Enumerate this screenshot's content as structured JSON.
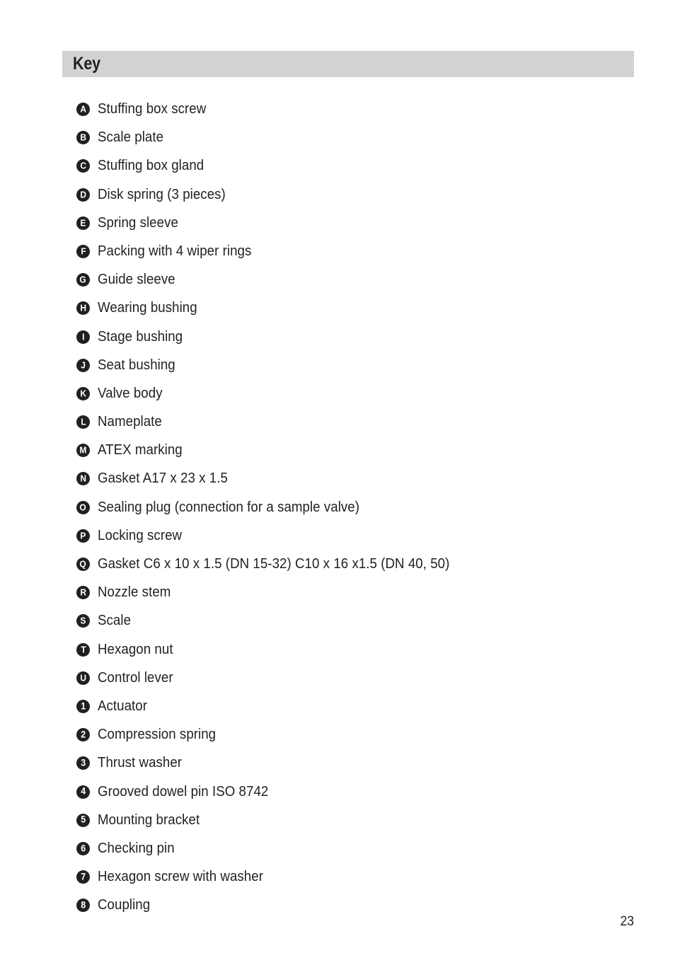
{
  "section": {
    "title": "Key",
    "header_bg": "#d2d2d2",
    "text_color": "#231f20"
  },
  "key_items": [
    {
      "marker": "A",
      "marker_type": "letter",
      "label": "Stuffing box screw"
    },
    {
      "marker": "B",
      "marker_type": "letter",
      "label": "Scale plate"
    },
    {
      "marker": "C",
      "marker_type": "letter",
      "label": "Stuffing box gland"
    },
    {
      "marker": "D",
      "marker_type": "letter",
      "label": "Disk spring (3 pieces)"
    },
    {
      "marker": "E",
      "marker_type": "letter",
      "label": "Spring sleeve"
    },
    {
      "marker": "F",
      "marker_type": "letter",
      "label": "Packing with 4 wiper rings"
    },
    {
      "marker": "G",
      "marker_type": "letter",
      "label": "Guide sleeve"
    },
    {
      "marker": "H",
      "marker_type": "letter",
      "label": "Wearing bushing"
    },
    {
      "marker": "I",
      "marker_type": "letter",
      "label": "Stage bushing"
    },
    {
      "marker": "J",
      "marker_type": "letter",
      "label": "Seat bushing"
    },
    {
      "marker": "K",
      "marker_type": "letter",
      "label": "Valve body"
    },
    {
      "marker": "L",
      "marker_type": "letter",
      "label": "Nameplate"
    },
    {
      "marker": "M",
      "marker_type": "letter",
      "label": "ATEX marking"
    },
    {
      "marker": "N",
      "marker_type": "letter",
      "label": "Gasket A17 x 23 x 1.5"
    },
    {
      "marker": "O",
      "marker_type": "letter",
      "label": "Sealing plug (connection for a sample valve)"
    },
    {
      "marker": "P",
      "marker_type": "letter",
      "label": "Locking screw"
    },
    {
      "marker": "Q",
      "marker_type": "letter",
      "label": "Gasket C6 x 10 x 1.5 (DN 15-32) C10 x 16 x1.5 (DN 40, 50)"
    },
    {
      "marker": "R",
      "marker_type": "letter",
      "label": "Nozzle stem"
    },
    {
      "marker": "S",
      "marker_type": "letter",
      "label": "Scale"
    },
    {
      "marker": "T",
      "marker_type": "letter",
      "label": "Hexagon nut"
    },
    {
      "marker": "U",
      "marker_type": "letter",
      "label": "Control lever"
    },
    {
      "marker": "1",
      "marker_type": "number",
      "label": "Actuator"
    },
    {
      "marker": "2",
      "marker_type": "number",
      "label": "Compression spring"
    },
    {
      "marker": "3",
      "marker_type": "number",
      "label": "Thrust washer"
    },
    {
      "marker": "4",
      "marker_type": "number",
      "label": "Grooved dowel pin ISO 8742"
    },
    {
      "marker": "5",
      "marker_type": "number",
      "label": "Mounting bracket"
    },
    {
      "marker": "6",
      "marker_type": "number",
      "label": "Checking pin"
    },
    {
      "marker": "7",
      "marker_type": "number",
      "label": "Hexagon screw with washer"
    },
    {
      "marker": "8",
      "marker_type": "number",
      "label": "Coupling"
    }
  ],
  "footer": {
    "page_number": "23"
  }
}
